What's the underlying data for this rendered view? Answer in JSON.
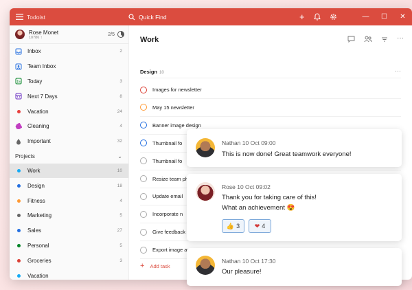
{
  "app": {
    "title": "Todoist",
    "search_placeholder": "Quick Find",
    "brand_color": "#db4c3f"
  },
  "user": {
    "name": "Rose Monet",
    "karma": "10786 ↑",
    "progress": "2/5"
  },
  "nav": [
    {
      "label": "Inbox",
      "count": "2",
      "icon": "inbox-icon",
      "color": "#246fe0"
    },
    {
      "label": "Team Inbox",
      "count": "",
      "icon": "team-inbox-icon",
      "color": "#246fe0"
    },
    {
      "label": "Today",
      "count": "3",
      "icon": "today-icon",
      "color": "#058527"
    },
    {
      "label": "Next 7 Days",
      "count": "8",
      "icon": "calendar-icon",
      "color": "#692fc2"
    },
    {
      "label": "Vacation",
      "count": "24",
      "icon": "label-dot-icon",
      "color": "#e8403e"
    },
    {
      "label": "Cleaning",
      "count": "4",
      "icon": "label-icon",
      "color": "#c13ec1"
    },
    {
      "label": "Important",
      "count": "32",
      "icon": "droplet-icon",
      "color": "#666666"
    }
  ],
  "projects": {
    "header": "Projects",
    "items": [
      {
        "label": "Work",
        "count": "10",
        "color": "#14aaf5"
      },
      {
        "label": "Design",
        "count": "18",
        "color": "#246fe0"
      },
      {
        "label": "Fitness",
        "count": "4",
        "color": "#ff9933"
      },
      {
        "label": "Marketing",
        "count": "5",
        "color": "#666666"
      },
      {
        "label": "Sales",
        "count": "27",
        "color": "#246fe0"
      },
      {
        "label": "Personal",
        "count": "5",
        "color": "#058527"
      },
      {
        "label": "Groceries",
        "count": "3",
        "color": "#db4035"
      },
      {
        "label": "Vacation",
        "count": "",
        "color": "#14aaf5"
      }
    ]
  },
  "main": {
    "title": "Work",
    "section_name": "Design",
    "section_count": "10",
    "tasks": [
      {
        "label": "Images for newsletter",
        "color": "#db4035"
      },
      {
        "label": "May 15 newsletter",
        "color": "#ff9933"
      },
      {
        "label": "Banner image design",
        "color": "#246fe0"
      },
      {
        "label": "Thumbnail fo",
        "color": "#246fe0"
      },
      {
        "label": "Thumbnail fo",
        "color": "#aaaaaa"
      },
      {
        "label": "Resize team photo",
        "color": "#aaaaaa"
      },
      {
        "label": "Update email",
        "color": "#aaaaaa"
      },
      {
        "label": "Incorporate n",
        "color": "#aaaaaa"
      },
      {
        "label": "Give feedback",
        "color": "#aaaaaa"
      },
      {
        "label": "Export image assets",
        "color": "#aaaaaa"
      }
    ],
    "add_task": "Add task"
  },
  "comments": [
    {
      "name": "Nathan",
      "time": "10 Oct 09:00",
      "lines": [
        "This is now done! Great teamwork everyone!"
      ]
    },
    {
      "name": "Rose",
      "time": "10 Oct 09:02",
      "lines": [
        "Thank you for taking care of this!",
        "What an achievement 😍"
      ],
      "reactions": [
        {
          "icon": "thumbs-up-icon",
          "count": "3"
        },
        {
          "icon": "heart-icon",
          "count": "4"
        }
      ]
    },
    {
      "name": "Nathan",
      "time": "10 Oct 17:30",
      "lines": [
        "Our pleasure!"
      ]
    }
  ]
}
